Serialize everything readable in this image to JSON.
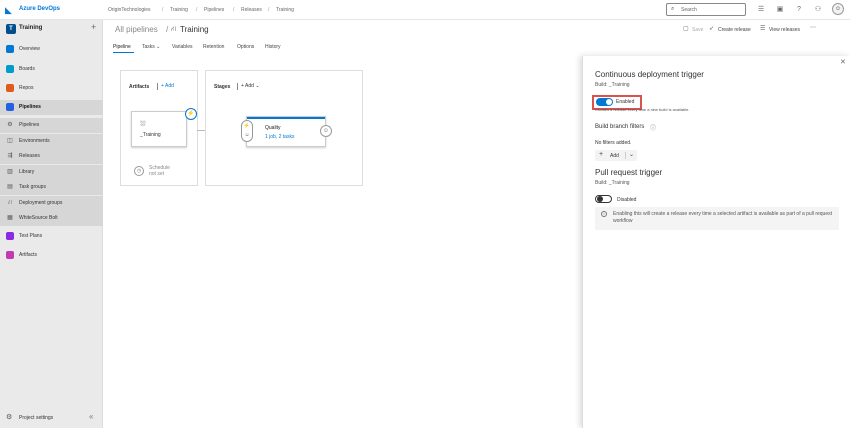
{
  "topbar": {
    "product": "Azure DevOps",
    "breadcrumb": [
      "OriginTechnologies",
      "Training",
      "Pipelines",
      "Releases",
      "Training"
    ],
    "search_placeholder": "Search"
  },
  "sidebar": {
    "project_initial": "T",
    "project_name": "Training",
    "items": [
      {
        "label": "Overview",
        "color": "#0078d4"
      },
      {
        "label": "Boards",
        "color": "#009ccc"
      },
      {
        "label": "Repos",
        "color": "#e05b1b"
      },
      {
        "label": "Pipelines",
        "color": "#2560e0"
      },
      {
        "label": "Pipelines"
      },
      {
        "label": "Environments"
      },
      {
        "label": "Releases"
      },
      {
        "label": "Library"
      },
      {
        "label": "Task groups"
      },
      {
        "label": "Deployment groups"
      },
      {
        "label": "WhiteSource Bolt"
      },
      {
        "label": "Test Plans",
        "color": "#8a2be2"
      },
      {
        "label": "Artifacts",
        "color": "#c239b3"
      }
    ],
    "settings_label": "Project settings"
  },
  "header": {
    "parent": "All pipelines",
    "title": "Training",
    "tabs": [
      "Pipeline",
      "Tasks",
      "Variables",
      "Retention",
      "Options",
      "History"
    ],
    "actions": {
      "save": "Save",
      "create_release": "Create release",
      "view_releases": "View releases"
    }
  },
  "canvas": {
    "artifacts_title": "Artifacts",
    "stages_title": "Stages",
    "add_label": "Add",
    "artifact_name": "_Training",
    "schedule_line1": "Schedule",
    "schedule_line2": "not set",
    "stage_name": "Quality",
    "stage_sub": "1 job, 2 tasks"
  },
  "panel": {
    "cd_title": "Continuous deployment trigger",
    "cd_source": "Build: _Training",
    "cd_toggle_label": "Enabled",
    "cd_desc": "Creates a release every time a new build is available.",
    "filters_title": "Build branch filters",
    "no_filters": "No filters added.",
    "add_label": "Add",
    "pr_title": "Pull request trigger",
    "pr_source": "Build: _Training",
    "pr_toggle_label": "Disabled",
    "pr_info": "Enabling this will create a release every time a selected artifact is available as part of a pull request workflow"
  }
}
